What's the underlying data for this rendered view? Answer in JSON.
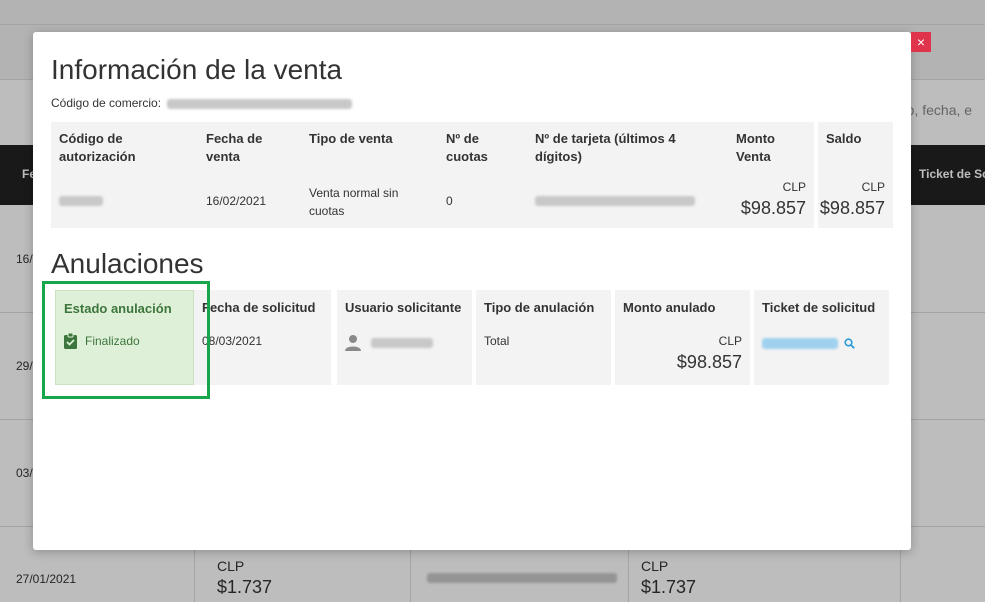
{
  "background": {
    "search_placeholder": "nto, fecha, e",
    "table_header": {
      "first_col": "Fe",
      "last_col": "Ticket de Sc"
    },
    "row_dates": [
      "16/",
      "29/",
      "03/"
    ],
    "last_row": {
      "date": "27/01/2021",
      "currency": "CLP",
      "amount": "$1.737",
      "currency2": "CLP",
      "amount2": "$1.737"
    }
  },
  "modal": {
    "close_label": "×",
    "title": "Información de la venta",
    "merchant_label": "Código de comercio:",
    "sale_table": {
      "headers": {
        "auth_code": "Código de autorización",
        "sale_date": "Fecha de venta",
        "sale_type": "Tipo de venta",
        "installments": "Nº de cuotas",
        "card_number": "Nº de tarjeta (últimos 4 dígitos)",
        "sale_amount": "Monto Venta",
        "balance": "Saldo"
      },
      "row": {
        "sale_date": "16/02/2021",
        "sale_type": "Venta normal sin cuotas",
        "installments": "0",
        "sale_currency": "CLP",
        "sale_amount": "$98.857",
        "balance_currency": "CLP",
        "balance_amount": "$98.857"
      }
    },
    "annulments_title": "Anulaciones",
    "annulments_table": {
      "headers": {
        "status": "Estado anulación",
        "request_date": "Fecha de solicitud",
        "requesting_user": "Usuario solicitante",
        "annulment_type": "Tipo de anulación",
        "annulled_amount": "Monto anulado",
        "ticket": "Ticket de solicitud"
      },
      "row": {
        "status": "Finalizado",
        "request_date": "08/03/2021",
        "annulment_type": "Total",
        "currency": "CLP",
        "annulled_amount": "$98.857"
      }
    }
  },
  "colors": {
    "status_bg": "#dff0d8",
    "status_text": "#3c763d",
    "highlight_frame": "#17a74a",
    "close_button": "#e0334c",
    "link": "#2a9bd8"
  }
}
